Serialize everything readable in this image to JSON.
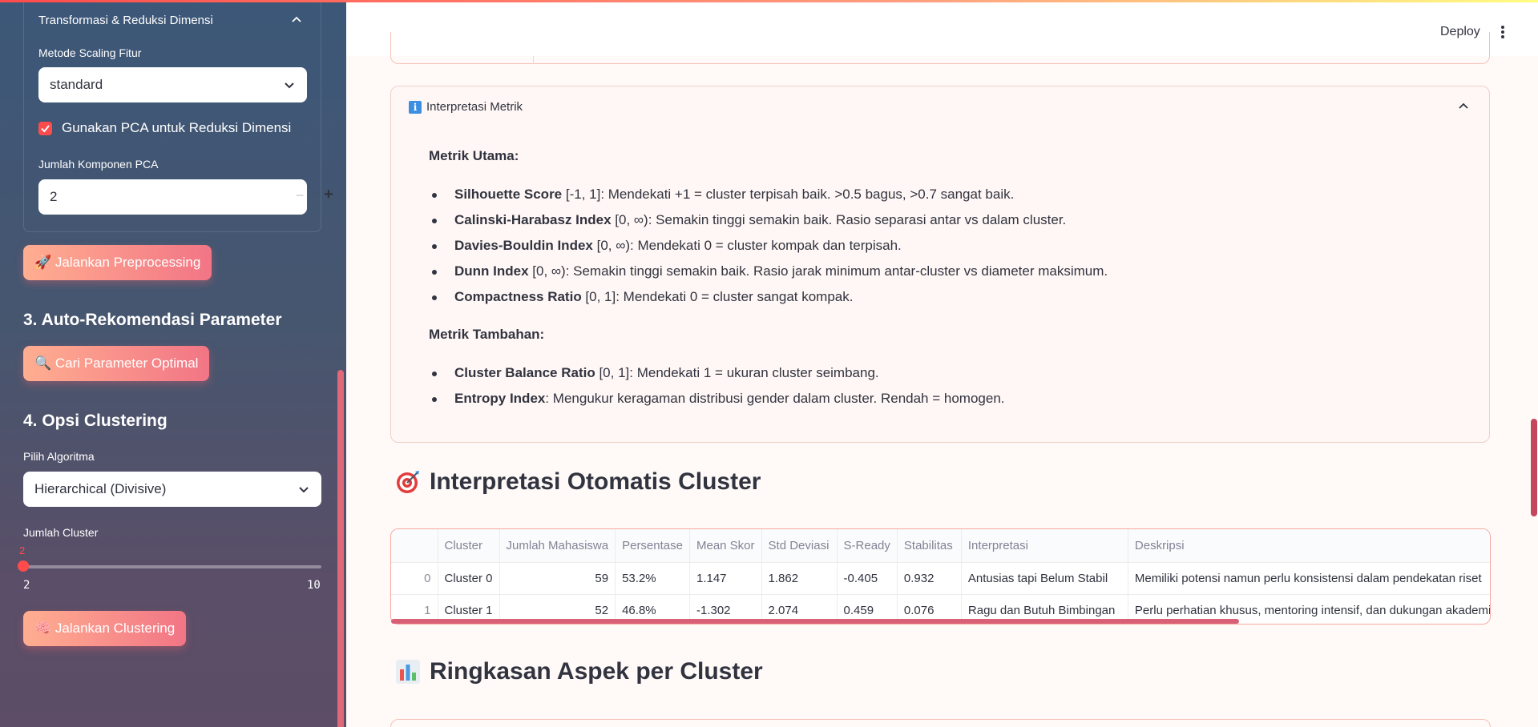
{
  "sidebar": {
    "expander_title": "Transformasi & Reduksi Dimensi",
    "scaling_label": "Metode Scaling Fitur",
    "scaling_value": "standard",
    "pca_checkbox_label": "Gunakan PCA untuk Reduksi Dimensi",
    "pca_checked": true,
    "pca_components_label": "Jumlah Komponen PCA",
    "pca_components_value": "2",
    "btn_preprocess": "🚀 Jalankan Preprocessing",
    "section3_title": "3. Auto-Rekomendasi Parameter",
    "btn_optimal": "🔍 Cari Parameter Optimal",
    "section4_title": "4. Opsi Clustering",
    "algo_label": "Pilih Algoritma",
    "algo_value": "Hierarchical (Divisive)",
    "cluster_label": "Jumlah Cluster",
    "cluster_value": "2",
    "cluster_min": "2",
    "cluster_max": "10",
    "btn_cluster": "🧠 Jalankan Clustering"
  },
  "header": {
    "deploy_label": "Deploy"
  },
  "metrics": {
    "expander_title": "Interpretasi Metrik",
    "main_heading": "Metrik Utama:",
    "main_items": [
      {
        "name": "Silhouette Score",
        "desc": " [-1, 1]: Mendekati +1 = cluster terpisah baik. >0.5 bagus, >0.7 sangat baik."
      },
      {
        "name": "Calinski-Harabasz Index",
        "desc": " [0, ∞): Semakin tinggi semakin baik. Rasio separasi antar vs dalam cluster."
      },
      {
        "name": "Davies-Bouldin Index",
        "desc": " [0, ∞): Mendekati 0 = cluster kompak dan terpisah."
      },
      {
        "name": "Dunn Index",
        "desc": " [0, ∞): Semakin tinggi semakin baik. Rasio jarak minimum antar-cluster vs diameter maksimum."
      },
      {
        "name": "Compactness Ratio",
        "desc": " [0, 1]: Mendekati 0 = cluster sangat kompak."
      }
    ],
    "extra_heading": "Metrik Tambahan:",
    "extra_items": [
      {
        "name": "Cluster Balance Ratio",
        "desc": " [0, 1]: Mendekati 1 = ukuran cluster seimbang."
      },
      {
        "name": "Entropy Index",
        "desc": ": Mengukur keragaman distribusi gender dalam cluster. Rendah = homogen."
      }
    ]
  },
  "interpretation": {
    "title": "Interpretasi Otomatis Cluster",
    "icon": "target-icon",
    "columns": [
      "",
      "Cluster",
      "Jumlah Mahasiswa",
      "Persentase",
      "Mean Skor",
      "Std Deviasi",
      "S-Ready",
      "Stabilitas",
      "Interpretasi",
      "Deskripsi"
    ],
    "rows": [
      [
        "0",
        "Cluster 0",
        "59",
        "53.2%",
        "1.147",
        "1.862",
        "-0.405",
        "0.932",
        "Antusias tapi Belum Stabil",
        "Memiliki potensi namun perlu konsistensi dalam pendekatan riset"
      ],
      [
        "1",
        "Cluster 1",
        "52",
        "46.8%",
        "-1.302",
        "2.074",
        "0.459",
        "0.076",
        "Ragu dan Butuh Bimbingan",
        "Perlu perhatian khusus, mentoring intensif, dan dukungan akademik"
      ]
    ]
  },
  "summary": {
    "title": "Ringkasan Aspek per Cluster",
    "icon": "bar-chart-icon"
  },
  "colors": {
    "accent": "#ff4b4b",
    "button_gradient_start": "#ffae91",
    "button_gradient_end": "#f27585",
    "info": "#3b8ee0"
  }
}
